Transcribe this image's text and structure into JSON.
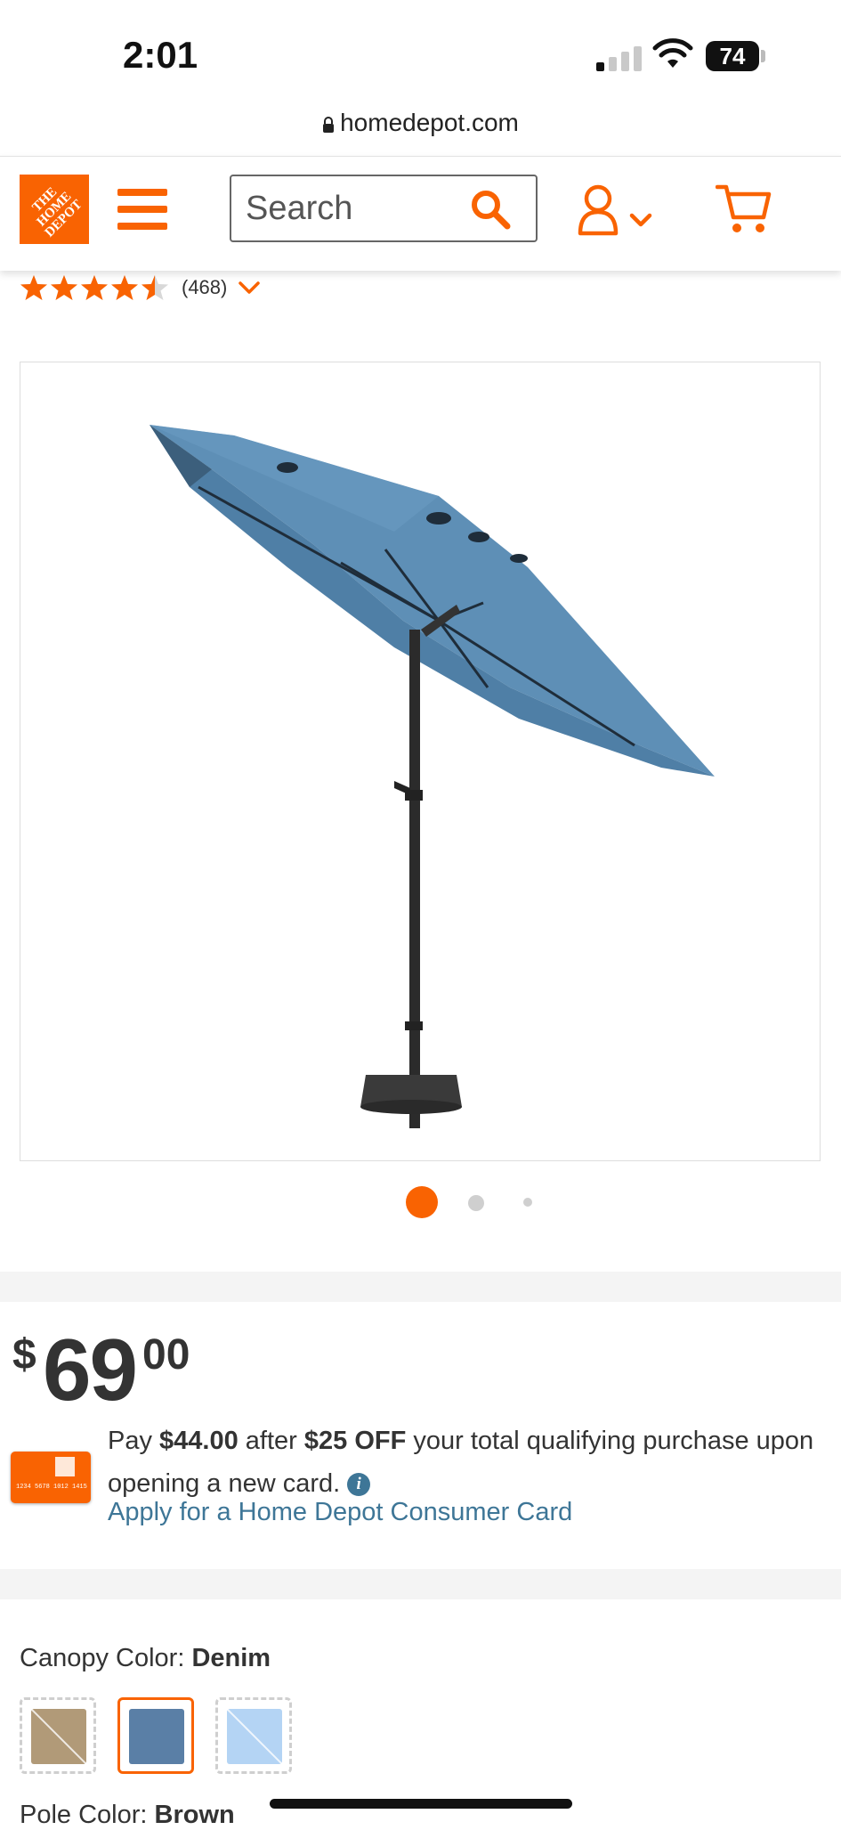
{
  "status_bar": {
    "time": "2:01",
    "battery": "74"
  },
  "browser": {
    "url": "homedepot.com"
  },
  "header": {
    "logo_text": "THE HOME DEPOT",
    "search_placeholder": "Search"
  },
  "product": {
    "rating_value": 4.5,
    "review_count": "(468)",
    "image_count": 3,
    "active_image_index": 0
  },
  "pricing": {
    "currency": "$",
    "dollars": "69",
    "cents": "00",
    "promo_prefix": "Pay ",
    "promo_after_price": "$44.00",
    "promo_middle": " after ",
    "promo_discount": "$25 OFF",
    "promo_suffix": " your total qualifying purchase upon opening a new card.",
    "apply_link": "Apply for a Home Depot Consumer Card",
    "card_number": "1234 5678 1012 1415"
  },
  "options": {
    "canopy_label": "Canopy Color: ",
    "canopy_value": "Denim",
    "swatches": [
      {
        "name": "Brown",
        "color": "#b19a78",
        "state": "unavailable"
      },
      {
        "name": "Denim",
        "color": "#5a7fa6",
        "state": "selected"
      },
      {
        "name": "Light Blue",
        "color": "#b4d4f4",
        "state": "unavailable"
      }
    ],
    "pole_label": "Pole Color: ",
    "pole_value": "Brown"
  },
  "colors": {
    "brand_orange": "#f96302",
    "link_blue": "#3e7697",
    "star_orange": "#f96302"
  }
}
